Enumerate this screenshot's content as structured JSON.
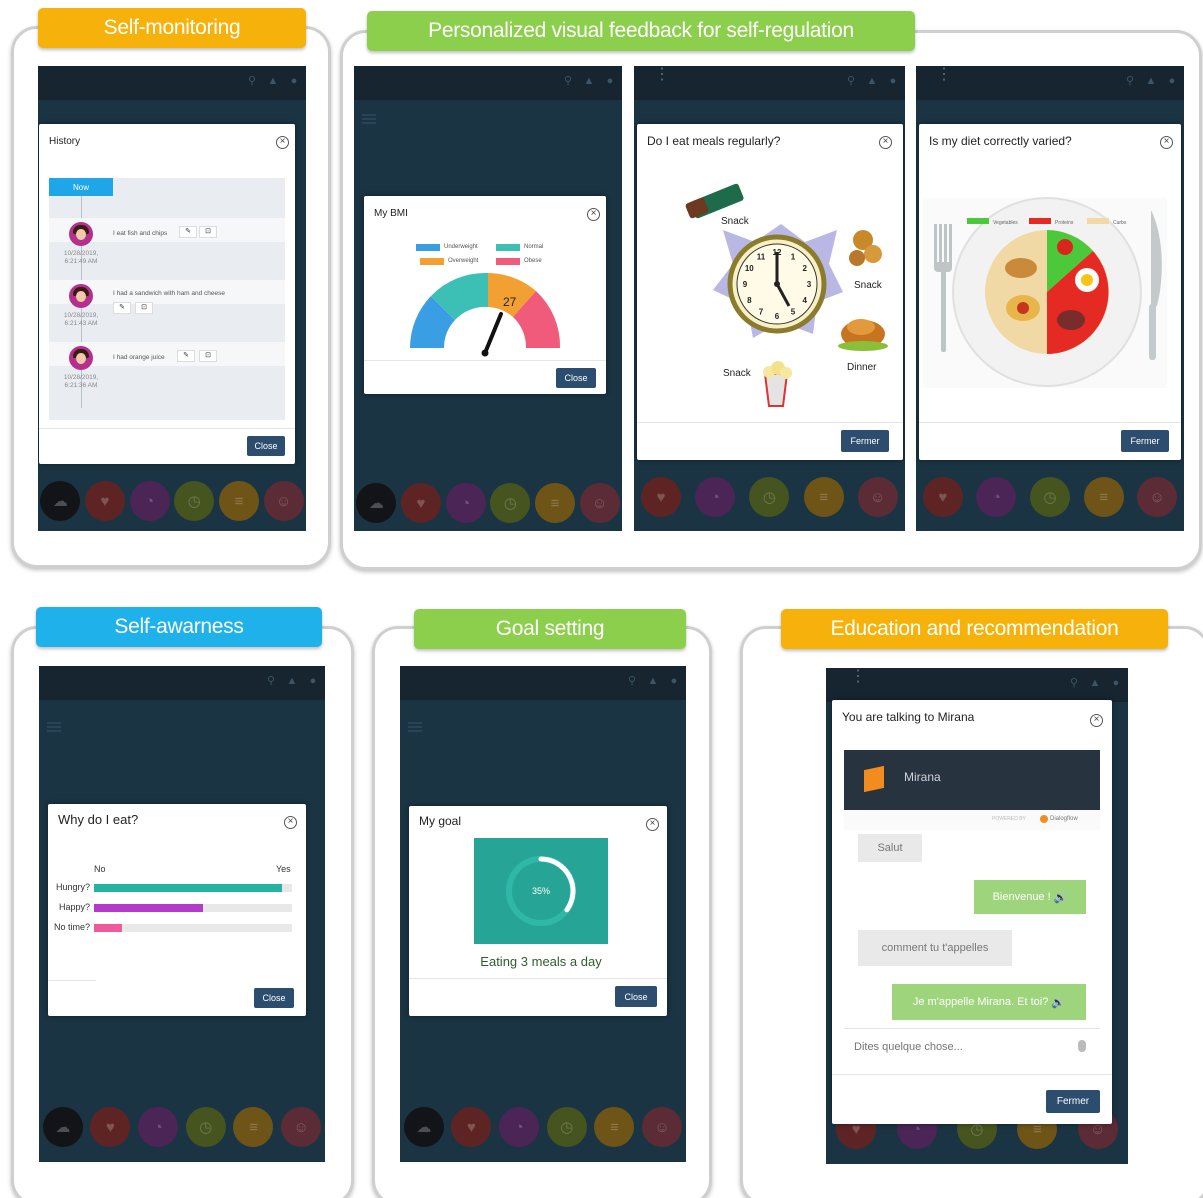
{
  "banners": {
    "self_monitoring": "Self-monitoring",
    "visual_feedback": "Personalized visual feedback for self-regulation",
    "self_awareness": "Self-awarness",
    "goal_setting": "Goal setting",
    "education": "Education and recommendation"
  },
  "history": {
    "title": "History",
    "now_label": "Now",
    "entries": [
      {
        "date": "10/28/2019,",
        "time": "6:21:49 AM",
        "text": "I eat fish and chips"
      },
      {
        "date": "10/28/2019,",
        "time": "6:21:43 AM",
        "text": "I had a sandwich with ham and cheese"
      },
      {
        "date": "10/28/2019,",
        "time": "6:21:36 AM",
        "text": "I had orange juice"
      }
    ],
    "close": "Close"
  },
  "bmi": {
    "title": "My BMI",
    "legend": [
      "Underweight",
      "Normal",
      "Overweight",
      "Obese"
    ],
    "value": "27",
    "close": "Close"
  },
  "meals": {
    "title": "Do I eat meals regularly?",
    "labels": {
      "snack_top": "Snack",
      "snack_right": "Snack",
      "dinner": "Dinner",
      "snack_bottom": "Snack"
    },
    "clock_numbers": [
      "12",
      "1",
      "2",
      "3",
      "4",
      "5",
      "6",
      "7",
      "8",
      "9",
      "10",
      "11"
    ],
    "close": "Fermer"
  },
  "diet": {
    "title": "Is my diet correctly varied?",
    "legend": [
      "Vegetables",
      "Proteins",
      "Carbs"
    ],
    "close": "Fermer"
  },
  "why_eat": {
    "title": "Why do I eat?",
    "no_label": "No",
    "yes_label": "Yes",
    "bars": [
      {
        "label": "Hungry?",
        "value": 0.95,
        "color": "#26b3a3"
      },
      {
        "label": "Happy?",
        "value": 0.55,
        "color": "#b43bc9"
      },
      {
        "label": "No time?",
        "value": 0.14,
        "color": "#ef5a9a"
      }
    ],
    "close": "Close"
  },
  "goal": {
    "title": "My goal",
    "percent_label": "35%",
    "progress": 0.35,
    "caption": "Eating 3 meals a day",
    "close": "Close"
  },
  "chat": {
    "title": "You are talking to Mirana",
    "bot_name": "Mirana",
    "powered_by": "POWERED BY",
    "provider": "Dialogflow",
    "messages": [
      {
        "from": "user",
        "text": "Salut"
      },
      {
        "from": "bot",
        "text": "Bienvenue !"
      },
      {
        "from": "user",
        "text": "comment tu t'appelles"
      },
      {
        "from": "bot",
        "text": "Je m'appelle Mirana. Et toi?"
      }
    ],
    "input_placeholder": "Dites quelque chose...",
    "close": "Fermer"
  },
  "colors": {
    "banner_orange": "#f6b10a",
    "banner_green": "#8ccf4d",
    "banner_blue": "#1fb1e9",
    "screen_bg": "#1a3443",
    "button": "#2c4d6e"
  }
}
